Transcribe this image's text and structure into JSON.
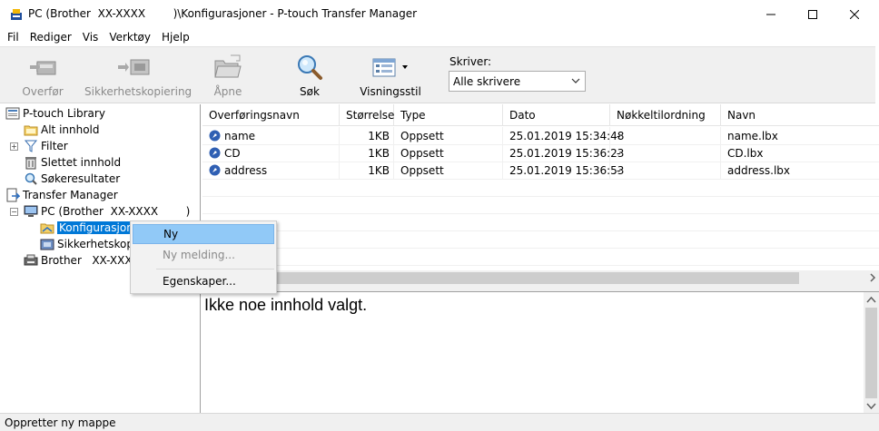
{
  "window": {
    "title": "PC (Brother  XX-XXXX        )\\Konfigurasjoner - P-touch Transfer Manager",
    "minimize_icon": "minimize-icon",
    "maximize_icon": "maximize-icon",
    "close_icon": "close-icon"
  },
  "menu": {
    "items": [
      "Fil",
      "Rediger",
      "Vis",
      "Verktøy",
      "Hjelp"
    ]
  },
  "toolbar": {
    "transfer_label": "Overfør",
    "backup_label": "Sikkerhetskopiering",
    "open_label": "Åpne",
    "search_label": "Søk",
    "view_label": "Visningsstil",
    "printer_label": "Skriver:",
    "printer_value": "Alle skrivere"
  },
  "tree": {
    "library": "P-touch Library",
    "all_content": "Alt innhold",
    "filter": "Filter",
    "deleted": "Slettet innhold",
    "search_results": "Søkeresultater",
    "transfer_manager": "Transfer Manager",
    "pc": "PC (Brother  XX-XXXX        )",
    "configurations": "Konfigurasjoner",
    "backups": "Sikkerhetskopier",
    "brother": "Brother   XX-XXXX"
  },
  "list": {
    "columns": [
      "Overføringsnavn",
      "Størrelse",
      "Type",
      "Dato",
      "Nøkkeltilordning",
      "Navn"
    ],
    "rows": [
      {
        "name": "name",
        "size": "1KB",
        "type": "Oppsett",
        "date": "25.01.2019 15:34:48",
        "key": "-",
        "file": "name.lbx"
      },
      {
        "name": "CD",
        "size": "1KB",
        "type": "Oppsett",
        "date": "25.01.2019 15:36:23",
        "key": "-",
        "file": "CD.lbx"
      },
      {
        "name": "address",
        "size": "1KB",
        "type": "Oppsett",
        "date": "25.01.2019 15:36:53",
        "key": "-",
        "file": "address.lbx"
      }
    ]
  },
  "preview": {
    "message": "Ikke noe innhold valgt."
  },
  "context_menu": {
    "new": "Ny",
    "new_message": "Ny melding...",
    "properties": "Egenskaper..."
  },
  "status": {
    "text": "Oppretter ny mappe"
  }
}
